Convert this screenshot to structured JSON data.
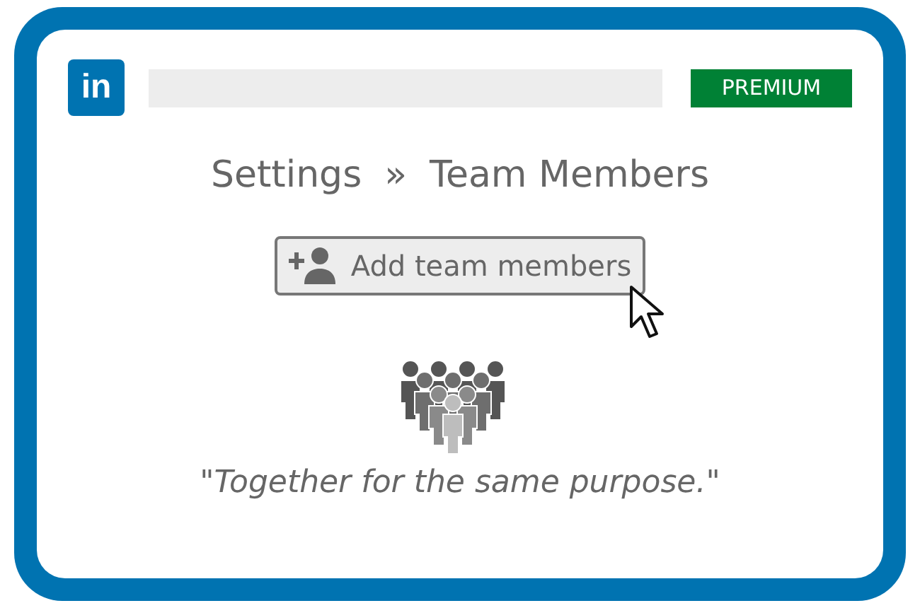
{
  "header": {
    "logo": "in",
    "badge": "PREMIUM"
  },
  "breadcrumb": [
    {
      "label": "Settings"
    },
    {
      "label": "»"
    },
    {
      "label": "Team Members"
    }
  ],
  "add_button": {
    "label": "Add team members"
  },
  "quote": "\"Together for the same purpose.\""
}
